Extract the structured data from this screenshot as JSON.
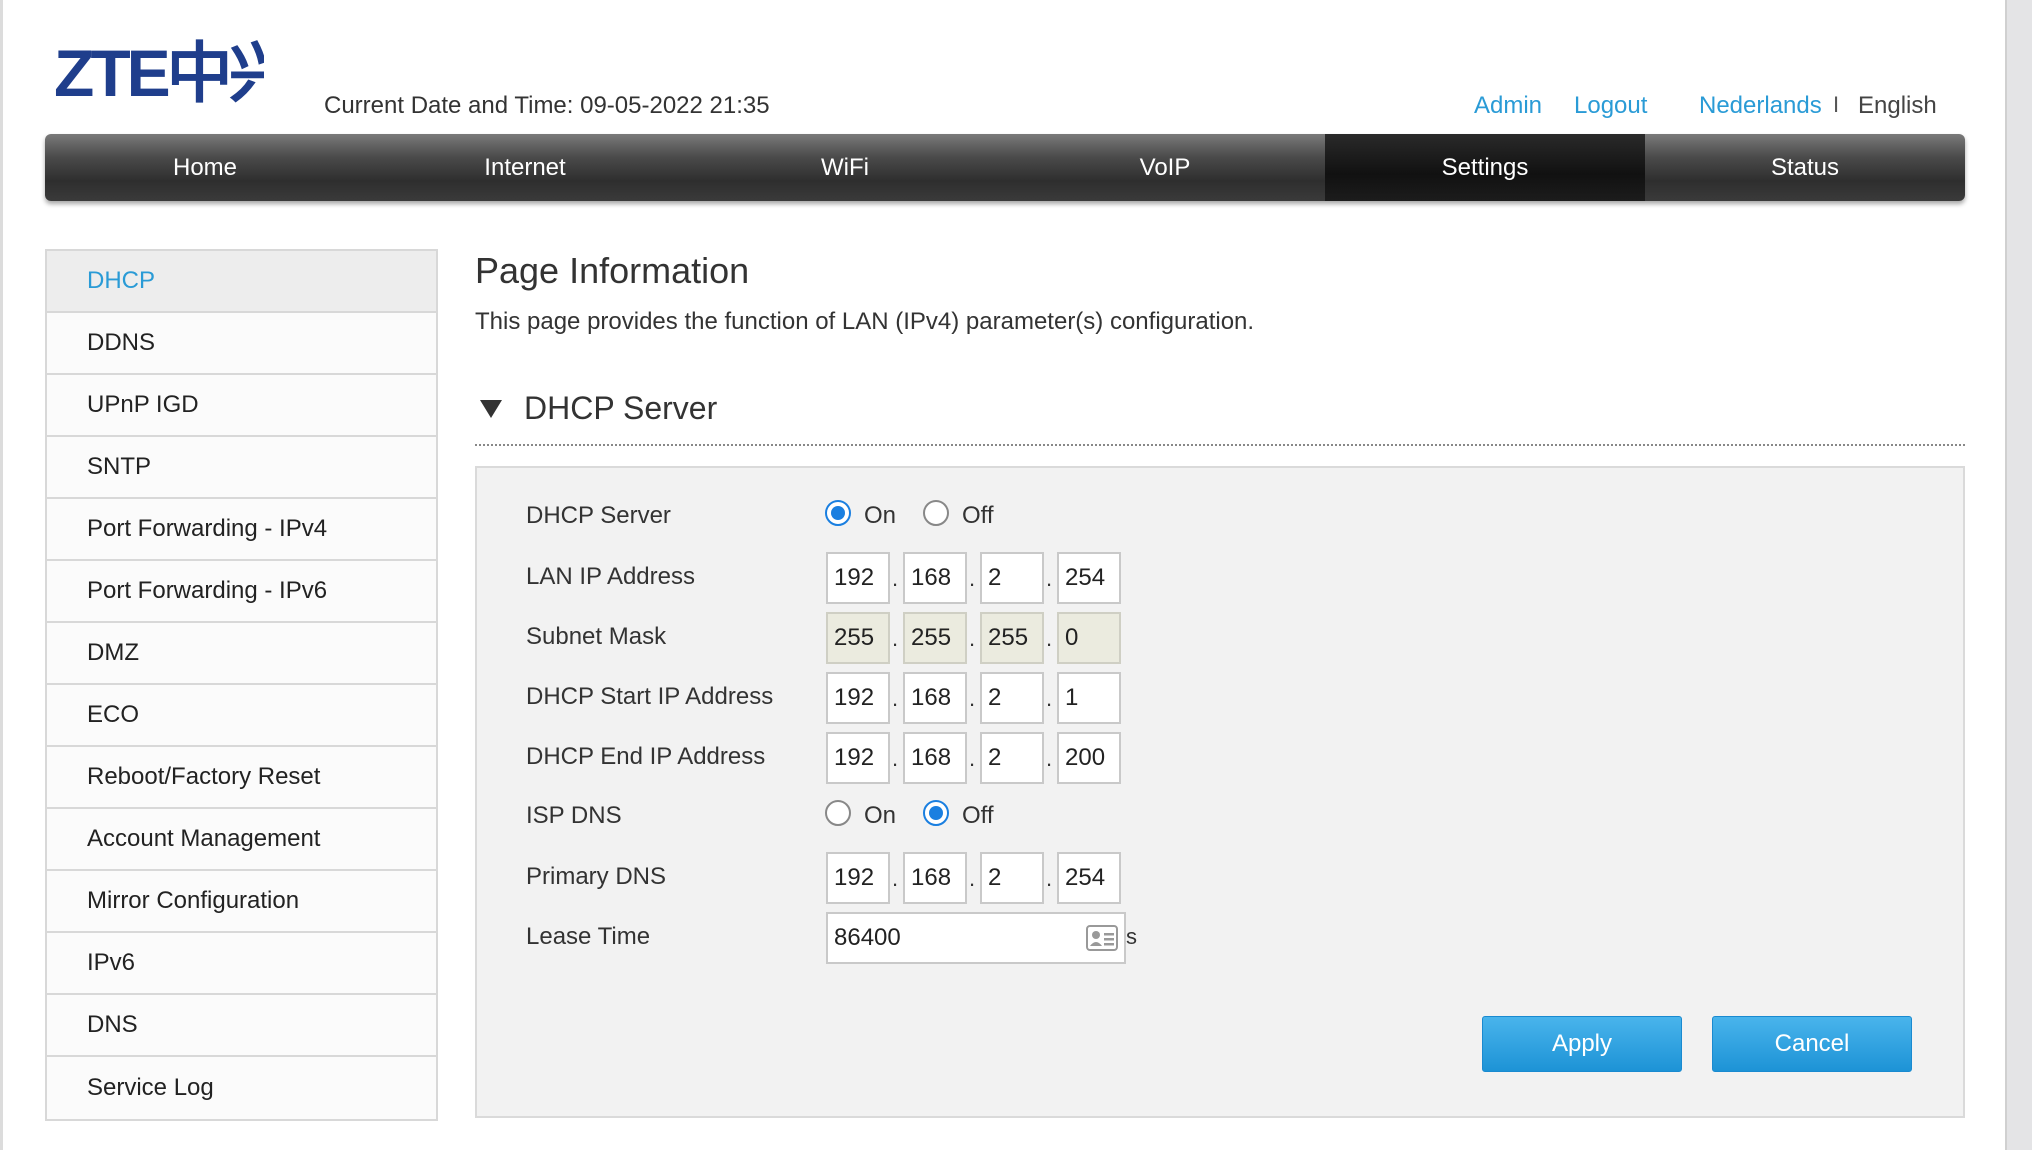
{
  "header": {
    "logo_text": "ZTE中兴",
    "datetime": "Current Date and Time: 09-05-2022 21:35",
    "admin_link": "Admin",
    "logout_link": "Logout",
    "lang_nl": "Nederlands",
    "lang_sep": "I",
    "lang_en": "English"
  },
  "nav": {
    "items": [
      {
        "label": "Home"
      },
      {
        "label": "Internet"
      },
      {
        "label": "WiFi"
      },
      {
        "label": "VoIP"
      },
      {
        "label": "Settings"
      },
      {
        "label": "Status"
      }
    ],
    "active": "Settings"
  },
  "sidebar": {
    "items": [
      {
        "label": "DHCP"
      },
      {
        "label": "DDNS"
      },
      {
        "label": "UPnP IGD"
      },
      {
        "label": "SNTP"
      },
      {
        "label": "Port Forwarding - IPv4"
      },
      {
        "label": "Port Forwarding - IPv6"
      },
      {
        "label": "DMZ"
      },
      {
        "label": "ECO"
      },
      {
        "label": "Reboot/Factory Reset"
      },
      {
        "label": "Account Management"
      },
      {
        "label": "Mirror Configuration"
      },
      {
        "label": "IPv6"
      },
      {
        "label": "DNS"
      },
      {
        "label": "Service Log"
      }
    ],
    "active": "DHCP"
  },
  "main": {
    "title": "Page Information",
    "description": "This page provides the function of LAN (IPv4) parameter(s) configuration.",
    "section_title": "DHCP Server"
  },
  "form": {
    "dhcp_server": {
      "label": "DHCP Server",
      "on_label": "On",
      "off_label": "Off",
      "value": "On"
    },
    "lan_ip": {
      "label": "LAN IP Address",
      "octets": [
        "192",
        "168",
        "2",
        "254"
      ]
    },
    "subnet_mask": {
      "label": "Subnet Mask",
      "octets": [
        "255",
        "255",
        "255",
        "0"
      ]
    },
    "start_ip": {
      "label": "DHCP Start IP Address",
      "octets": [
        "192",
        "168",
        "2",
        "1"
      ]
    },
    "end_ip": {
      "label": "DHCP End IP Address",
      "octets": [
        "192",
        "168",
        "2",
        "200"
      ]
    },
    "isp_dns": {
      "label": "ISP DNS",
      "on_label": "On",
      "off_label": "Off",
      "value": "Off"
    },
    "primary_dns": {
      "label": "Primary DNS",
      "octets": [
        "192",
        "168",
        "2",
        "254"
      ]
    },
    "lease_time": {
      "label": "Lease Time",
      "value": "86400",
      "unit": "s"
    },
    "dot": "."
  },
  "buttons": {
    "apply": "Apply",
    "cancel": "Cancel"
  },
  "colors": {
    "accent": "#2a9bd6",
    "button": "#2a9fe0",
    "nav_dark": "#2e2e2e",
    "radio": "#1a7fe0"
  },
  "icons": {
    "lease": "contact-card-icon",
    "section_toggle": "triangle-down-icon"
  }
}
